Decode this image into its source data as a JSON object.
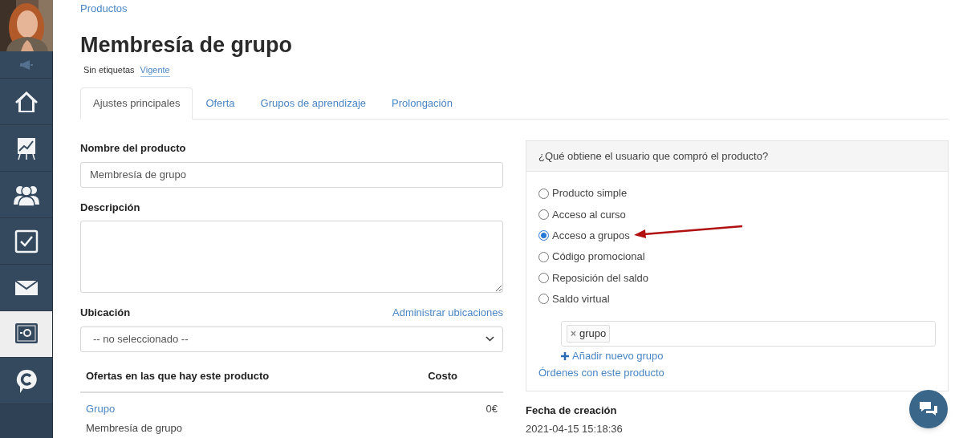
{
  "sidebar": {
    "items": [
      {
        "kind": "speaker",
        "selected": false
      },
      {
        "kind": "home",
        "selected": false
      },
      {
        "kind": "chart",
        "selected": false
      },
      {
        "kind": "users",
        "selected": false
      },
      {
        "kind": "check",
        "selected": false
      },
      {
        "kind": "mail",
        "selected": false
      },
      {
        "kind": "safe",
        "selected": true
      },
      {
        "kind": "chat",
        "selected": false
      }
    ]
  },
  "breadcrumb": "Productos",
  "title": "Membresía de grupo",
  "tags": {
    "label": "Sin etiquetas",
    "status": "Vigente"
  },
  "tabs": [
    {
      "label": "Ajustes principales",
      "selected": true
    },
    {
      "label": "Oferta",
      "selected": false
    },
    {
      "label": "Grupos de aprendizaje",
      "selected": false
    },
    {
      "label": "Prolongación",
      "selected": false
    }
  ],
  "form": {
    "name_label": "Nombre del producto",
    "name_value": "Membresía de grupo",
    "description_label": "Descripción",
    "location_label": "Ubicación",
    "location_link": "Administrar ubicaciones",
    "location_value": "-- no seleccionado --"
  },
  "offers_table": {
    "columns": [
      "Ofertas en las que hay este producto",
      "Costo"
    ],
    "rows": [
      {
        "offer": "Grupo",
        "product": "Membresía de grupo",
        "cost": "0€"
      }
    ]
  },
  "panel": {
    "title": "¿Qué obtiene el usuario que compró el producto?",
    "options": [
      {
        "label": "Producto simple",
        "selected": false
      },
      {
        "label": "Acceso al curso",
        "selected": false
      },
      {
        "label": "Acceso a grupos",
        "selected": true
      },
      {
        "label": "Código promocional",
        "selected": false
      },
      {
        "label": "Reposición del saldo",
        "selected": false
      },
      {
        "label": "Saldo virtual",
        "selected": false
      }
    ],
    "group_tags": [
      {
        "remove": "×",
        "label": "grupo"
      }
    ],
    "add_group": "Añadir nuevo grupo",
    "orders_link": "Órdenes con este producto"
  },
  "created": {
    "label": "Fecha de creación",
    "value": "2021-04-15 15:18:36"
  }
}
